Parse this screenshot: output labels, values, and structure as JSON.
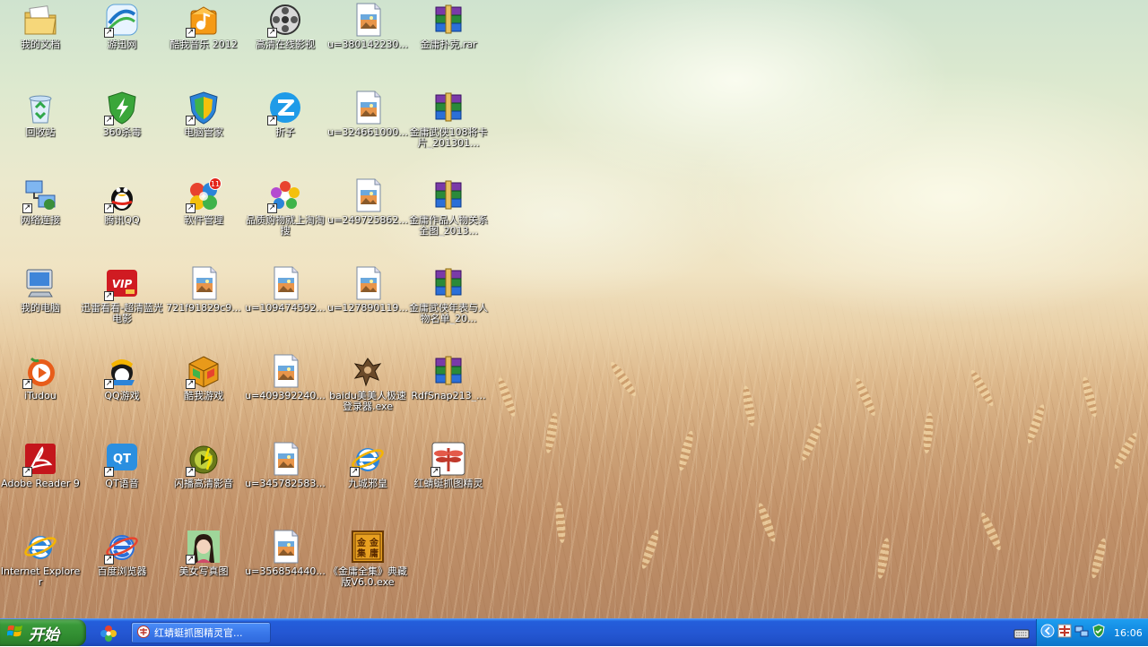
{
  "desktop": {
    "icons": [
      {
        "label": "我的文档",
        "icon": "documents-folder-icon",
        "shortcut": false
      },
      {
        "label": "回收站",
        "icon": "recycle-bin-icon",
        "shortcut": false
      },
      {
        "label": "网络连接",
        "icon": "network-connections-icon",
        "shortcut": true
      },
      {
        "label": "我的电脑",
        "icon": "my-computer-icon",
        "shortcut": false
      },
      {
        "label": "iTudou",
        "icon": "itudou-icon",
        "shortcut": true
      },
      {
        "label": "Adobe Reader 9",
        "icon": "adobe-reader-icon",
        "shortcut": true
      },
      {
        "label": "Internet Explorer",
        "icon": "internet-explorer-icon",
        "shortcut": false
      },
      {
        "label": "游迅网",
        "icon": "web-globe-icon",
        "shortcut": true
      },
      {
        "label": "360杀毒",
        "icon": "antivirus-shield-icon",
        "shortcut": true
      },
      {
        "label": "腾讯QQ",
        "icon": "qq-penguin-icon",
        "shortcut": true
      },
      {
        "label": "迅雷看看-超清蓝光电影",
        "icon": "vip-video-icon",
        "shortcut": true
      },
      {
        "label": "QQ游戏",
        "icon": "qq-game-icon",
        "shortcut": true
      },
      {
        "label": "QT语音",
        "icon": "qt-voice-icon",
        "shortcut": true
      },
      {
        "label": "百度浏览器",
        "icon": "baidu-browser-icon",
        "shortcut": true
      },
      {
        "label": "酷我音乐 2012",
        "icon": "music-player-icon",
        "shortcut": true
      },
      {
        "label": "电脑管家",
        "icon": "pc-manager-shield-icon",
        "shortcut": true
      },
      {
        "label": "软件管理",
        "icon": "software-manager-icon",
        "shortcut": true,
        "badge": "11"
      },
      {
        "label": "721f91829c9...",
        "icon": "image-file-icon",
        "shortcut": false
      },
      {
        "label": "酷我游戏",
        "icon": "game-cube-icon",
        "shortcut": true
      },
      {
        "label": "闪播高清影音",
        "icon": "media-player-icon",
        "shortcut": true
      },
      {
        "label": "美女写真图",
        "icon": "photo-portrait-icon",
        "shortcut": true
      },
      {
        "label": "高清在线影视",
        "icon": "film-reel-icon",
        "shortcut": true
      },
      {
        "label": "折子",
        "icon": "zhezi-icon",
        "shortcut": true
      },
      {
        "label": "品质购物就上淘淘搜",
        "icon": "shopping-flower-icon",
        "shortcut": true
      },
      {
        "label": "u=109474592...",
        "icon": "image-file-icon",
        "shortcut": false
      },
      {
        "label": "u=409392240...",
        "icon": "image-file-icon",
        "shortcut": false
      },
      {
        "label": "u=345782583...",
        "icon": "image-file-icon",
        "shortcut": false
      },
      {
        "label": "u=356854440...",
        "icon": "image-file-icon",
        "shortcut": false
      },
      {
        "label": "u=380142230...",
        "icon": "image-file-icon",
        "shortcut": false
      },
      {
        "label": "u=324661000...",
        "icon": "image-file-icon",
        "shortcut": false
      },
      {
        "label": "u=249725862...",
        "icon": "image-file-icon",
        "shortcut": false
      },
      {
        "label": "u=127890119...",
        "icon": "image-file-icon",
        "shortcut": false
      },
      {
        "label": "baidu美美人极速登录器.exe",
        "icon": "game-character-icon",
        "shortcut": false
      },
      {
        "label": "九城邪皇",
        "icon": "internet-explorer-icon",
        "shortcut": true
      },
      {
        "label": "《金庸全集》典藏版V6.0.exe",
        "icon": "jinyong-book-icon",
        "shortcut": false
      },
      {
        "label": "金庸扑克.rar",
        "icon": "rar-archive-icon",
        "shortcut": false
      },
      {
        "label": "金庸武侠108将卡片_201301...",
        "icon": "rar-archive-icon",
        "shortcut": false
      },
      {
        "label": "金庸作品人物关系全图_2013...",
        "icon": "rar-archive-icon",
        "shortcut": false
      },
      {
        "label": "金庸武侠年表与人物名单_20...",
        "icon": "rar-archive-icon",
        "shortcut": false
      },
      {
        "label": "RdfSnap213_...",
        "icon": "rar-archive-icon",
        "shortcut": false
      },
      {
        "label": "红蜻蜓抓图精灵",
        "icon": "dragonfly-capture-icon",
        "shortcut": true
      }
    ]
  },
  "taskbar": {
    "start_label": "开始",
    "quick_launch_icon": "quick-launch-flower-icon",
    "task_button_label": "红蜻蜓抓图精灵官...",
    "task_button_icon": "dragonfly-app-icon",
    "tray_icons": [
      "keyboard-icon",
      "tray-expand-icon",
      "tray-app-icon",
      "network-tray-icon",
      "security-shield-icon"
    ],
    "clock": "16:06"
  },
  "colors": {
    "taskbar_blue": "#245edb",
    "start_green": "#3a9a3a",
    "tray_blue": "#1188e0"
  }
}
